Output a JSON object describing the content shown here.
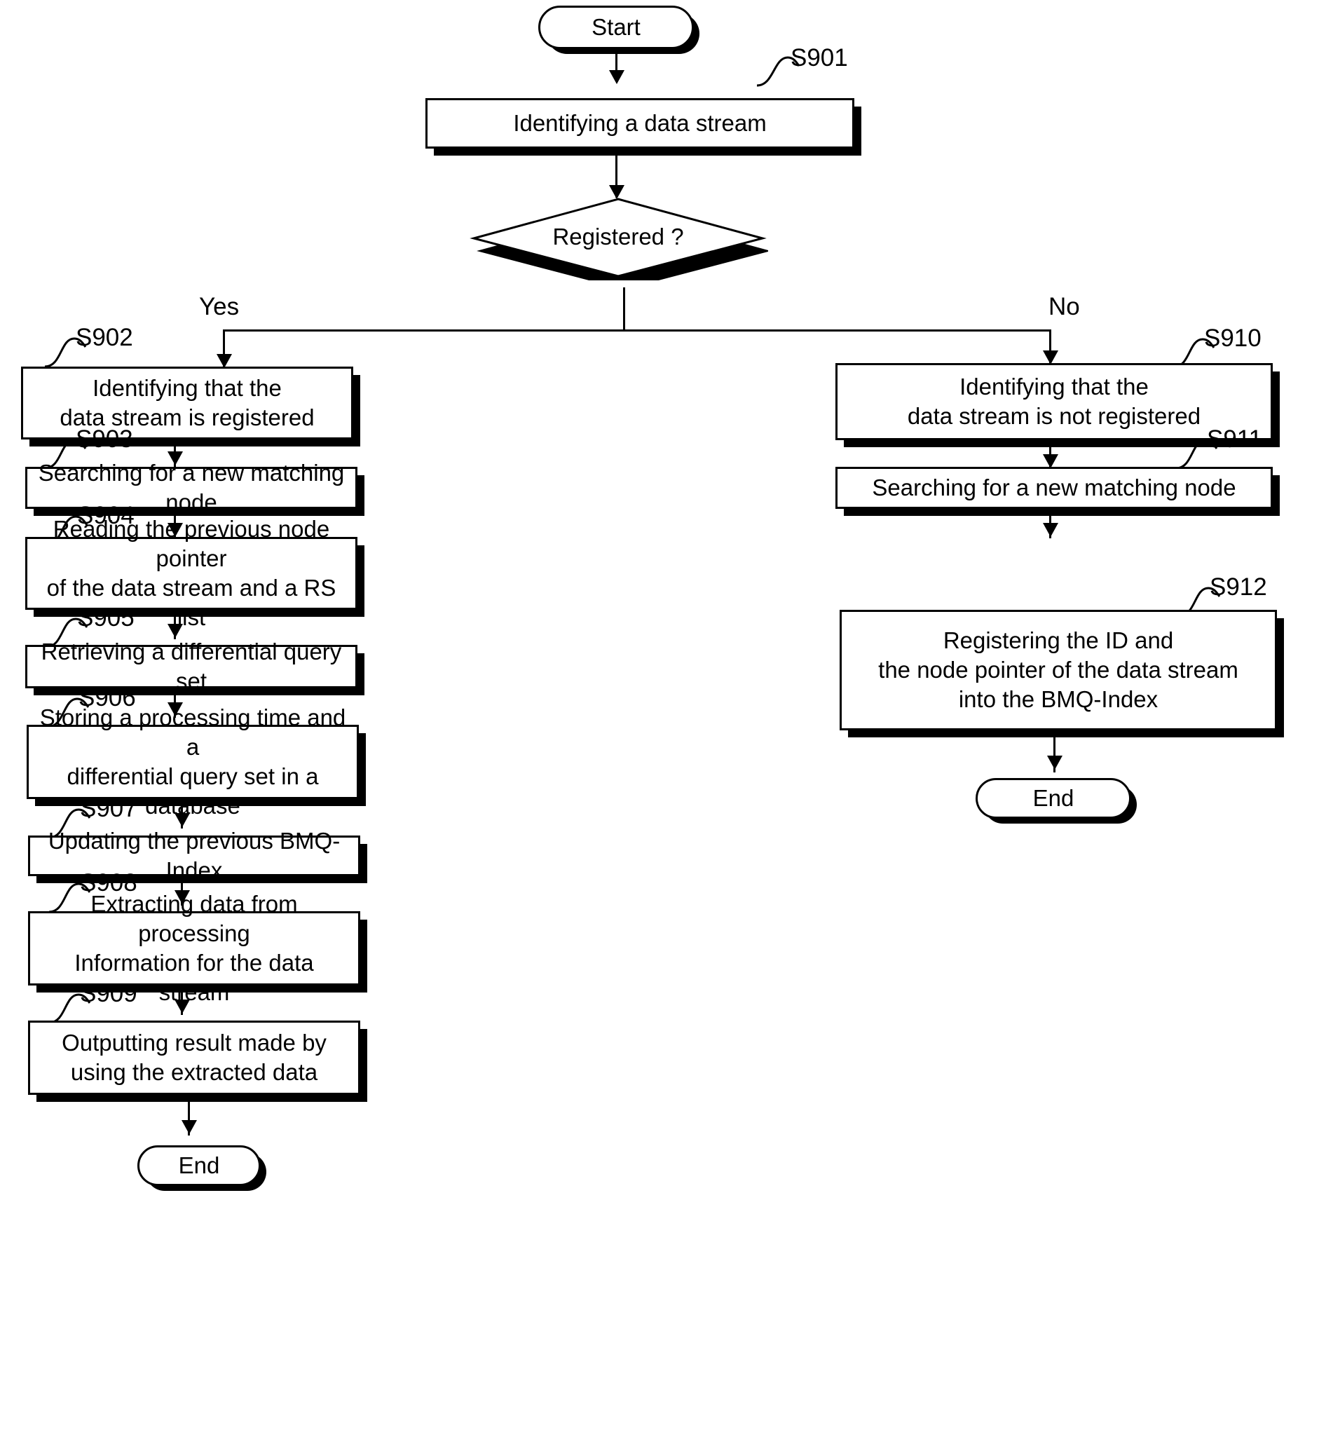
{
  "diagram": {
    "type": "flowchart",
    "title": "Data stream registration and query processing flow",
    "terminators": {
      "start": "Start",
      "end_left": "End",
      "end_right": "End"
    },
    "decision": {
      "label": "Registered ?",
      "yes_label": "Yes",
      "no_label": "No"
    },
    "steps": [
      {
        "ref": "S901",
        "text": "Identifying a data stream",
        "lines": [
          "Identifying a data stream"
        ]
      },
      {
        "ref": "S902",
        "text": "Identifying that the data stream is registered",
        "lines": [
          "Identifying that the",
          "data stream is registered"
        ]
      },
      {
        "ref": "S903",
        "text": "Searching for a new matching node",
        "lines": [
          "Searching for a new matching node"
        ]
      },
      {
        "ref": "S904",
        "text": "Reading the previous node pointer of the data stream and a RS list",
        "lines": [
          "Reading the previous node pointer",
          "of the data stream and a RS list"
        ]
      },
      {
        "ref": "S905",
        "text": "Retrieving a differential query set",
        "lines": [
          "Retrieving a differential query set"
        ]
      },
      {
        "ref": "S906",
        "text": "Storing a processing time and a differential query set in a database",
        "lines": [
          "Storing a processing time and a",
          "differential query set in a database"
        ]
      },
      {
        "ref": "S907",
        "text": "Updating the previous BMQ-Index",
        "lines": [
          "Updating the previous BMQ-Index"
        ]
      },
      {
        "ref": "S908",
        "text": "Extracting data from processing Information for the data stream",
        "lines": [
          "Extracting data from processing",
          "Information for the data stream"
        ]
      },
      {
        "ref": "S909",
        "text": "Outputting result made by using the extracted data",
        "lines": [
          "Outputting result made by",
          "using the extracted data"
        ]
      },
      {
        "ref": "S910",
        "text": "Identifying that the data stream is not registered",
        "lines": [
          "Identifying that the",
          "data stream is not registered"
        ]
      },
      {
        "ref": "S911",
        "text": "Searching for a new matching node",
        "lines": [
          "Searching for a new matching node"
        ]
      },
      {
        "ref": "S912",
        "text": "Registering the ID and the node pointer of the data stream into the BMQ-Index",
        "lines": [
          "Registering the ID and",
          "the node pointer of the data stream",
          "into the BMQ-Index"
        ]
      }
    ],
    "colors": {
      "stroke": "#000000",
      "fill": "#ffffff",
      "shadow": "#000000"
    }
  }
}
